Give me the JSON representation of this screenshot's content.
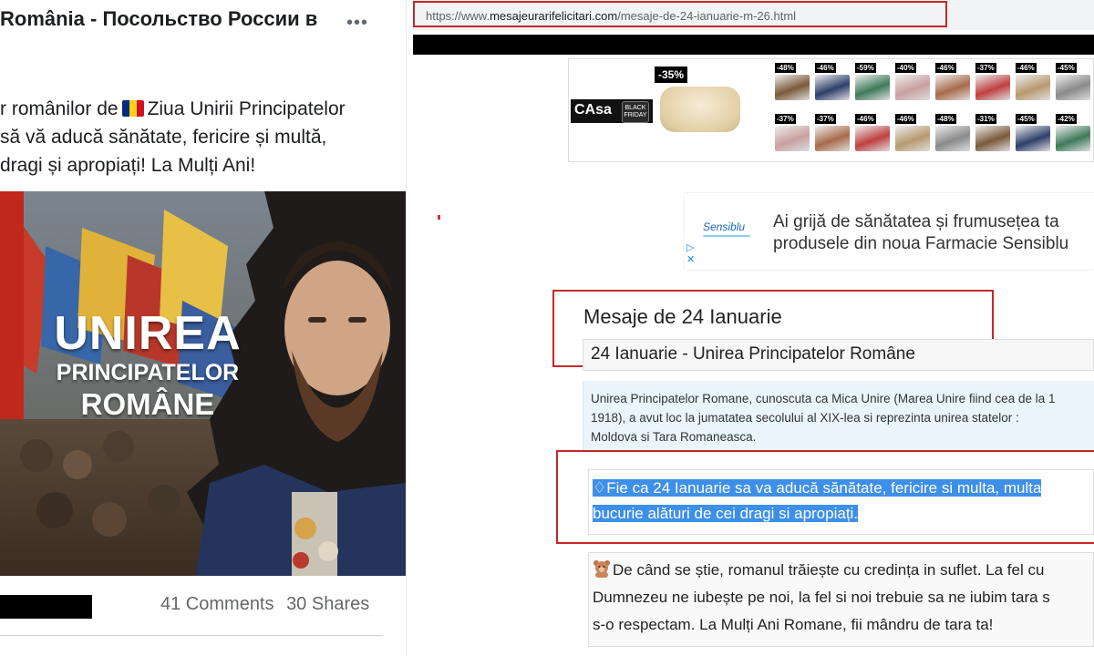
{
  "facebook": {
    "page_title": "România - Посольство России в",
    "more_label": "•••",
    "post_lines": [
      "r românilor de",
      "Ziua Unirii Principatelor",
      "să vă aducă sănătate, fericire și multă,",
      "dragi și apropiați! La Mulți Ani!"
    ],
    "image": {
      "title_line1": "UNIREA",
      "title_line2": "PRINCIPATELOR",
      "title_line3": "ROMÂNE"
    },
    "comments": "41 Comments",
    "shares": "30 Shares",
    "flag_colors": [
      "#002b7f",
      "#fcd116",
      "#ce1126"
    ]
  },
  "browser": {
    "url_scheme": "https://www.",
    "url_host": "mesajeurarifelicitari.com",
    "url_path": "/mesaje-de-24-ianuarie-m-26.html",
    "ad_banner": {
      "brand": "CΑsa",
      "black_friday": "BLACK FRIDAY",
      "main_discount": "-35%",
      "row1": [
        "-48%",
        "-46%",
        "-59%",
        "-40%",
        "-46%",
        "-37%",
        "-46%",
        "-45%"
      ],
      "row2": [
        "-37%",
        "-37%",
        "-46%",
        "-46%",
        "-48%",
        "-31%",
        "-45%",
        "-42%"
      ]
    },
    "ad2": {
      "logo": "Sensiblu",
      "line1": "Ai grijă de sănătatea și frumusețea ta",
      "line2": "produsele din noua Farmacie Sensiblu",
      "choices_icon": "▷",
      "close_icon": "✕"
    },
    "heading": "Mesaje de 24 Ianuarie",
    "subheading": "24 Ianuarie - Unirea Principatelor Române",
    "info_lines": [
      "Unirea Principatelor Romane, cunoscuta ca Mica Unire (Marea Unire fiind cea de la 1",
      "1918), a avut loc la jumatatea secolului al XIX-lea si reprezinta unirea statelor :",
      "Moldova si Tara Romaneasca."
    ],
    "message1_lines": [
      "Fie ca 24 Ianuarie sa va aducă sănătate, fericire si multa, multa",
      "bucurie alături de cei dragi si apropiați."
    ],
    "message2_lines": [
      "De când se știe, romanul trăiește cu credința in suflet. La fel cu",
      "Dumnezeu ne iubește pe noi, la fel si noi trebuie sa ne iubim tara s",
      "s-o respectam. La Mulți Ani Romane, fii mândru de tara ta!"
    ],
    "highlight_color": "#3d8fe8",
    "annotation_color": "#c62828"
  }
}
